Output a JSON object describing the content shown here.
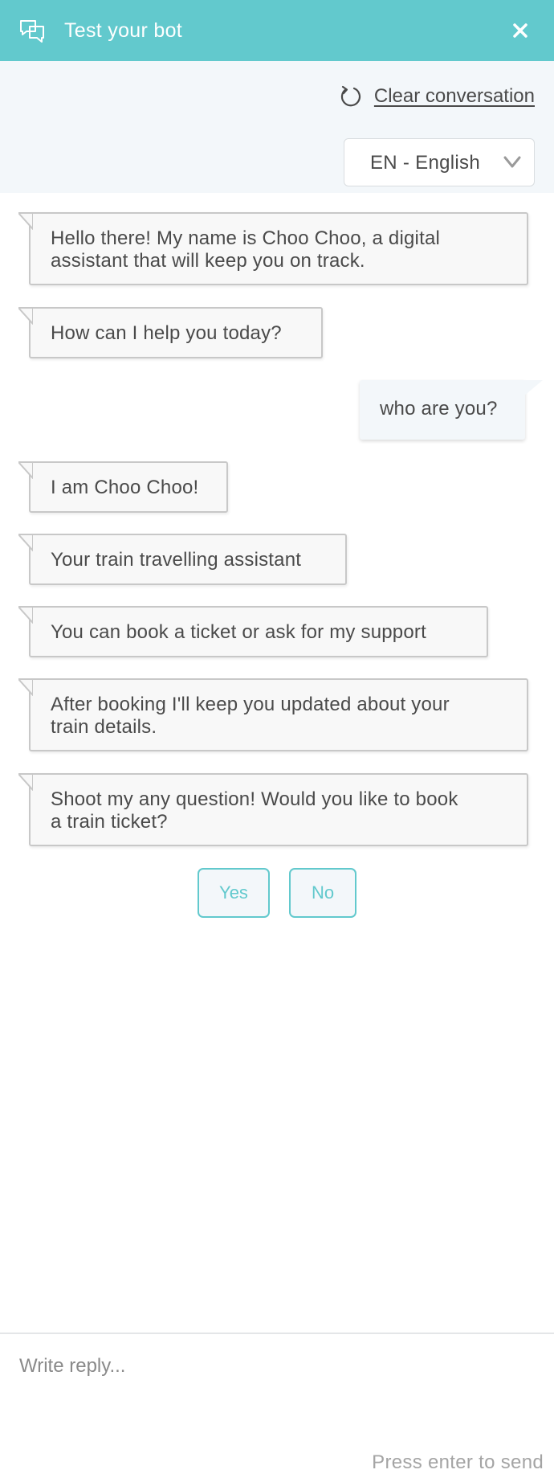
{
  "header": {
    "title": "Test your bot",
    "icon": "chat-bubbles-icon",
    "close_icon": "close-icon",
    "background": "#62c9cd"
  },
  "toolbar": {
    "clear_label": "Clear conversation",
    "clear_icon": "refresh-icon",
    "language": {
      "selected": "EN - English",
      "icon": "chevron-down-icon"
    }
  },
  "conversation": {
    "messages": [
      {
        "from": "bot",
        "text_lines": [
          "Hello there! My name is Choo Choo, a digital",
          "assistant that will keep you on track."
        ]
      },
      {
        "from": "bot",
        "text_lines": [
          "How can I help you today?"
        ]
      },
      {
        "from": "user",
        "text_lines": [
          "who are you?"
        ]
      },
      {
        "from": "bot",
        "text_lines": [
          "I am Choo Choo!"
        ]
      },
      {
        "from": "bot",
        "text_lines": [
          "Your train travelling assistant"
        ]
      },
      {
        "from": "bot",
        "text_lines": [
          "You can book a ticket or ask for my support"
        ]
      },
      {
        "from": "bot",
        "text_lines": [
          "After booking I'll keep you updated about your",
          "train details."
        ]
      },
      {
        "from": "bot",
        "text_lines": [
          "Shoot my any question! Would you like to book",
          "a train ticket?"
        ]
      }
    ],
    "quick_replies": [
      "Yes",
      "No"
    ]
  },
  "composer": {
    "placeholder": "Write reply...",
    "hint": "Press enter to send"
  },
  "colors": {
    "accent": "#62c9cd",
    "panel_bg": "#f3f7fa",
    "bot_bubble_bg": "#f8f8f8",
    "bot_bubble_border": "#c8c8c8"
  }
}
